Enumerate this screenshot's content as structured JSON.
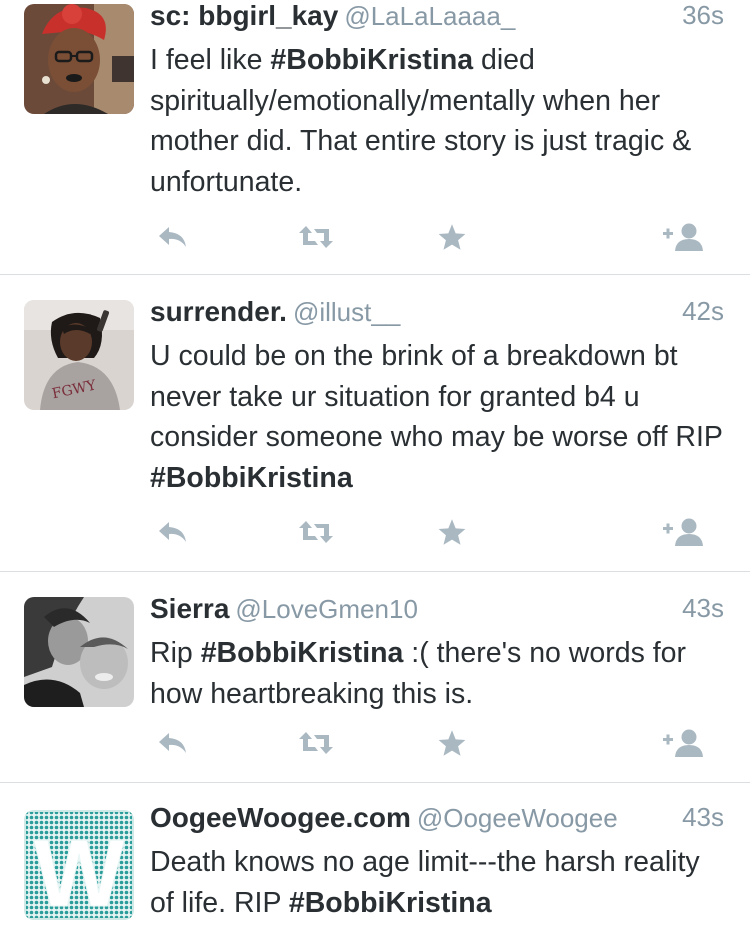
{
  "tweets": [
    {
      "name": "sc: bbgirl_kay",
      "handle": "@LaLaLaaaa_",
      "time": "36s",
      "text_before": "I feel like ",
      "hashtag": "#BobbiKristina",
      "text_after": " died spiritually/emotionally/mentally when her mother did. That entire story is just tragic & unfortunate."
    },
    {
      "name": "surrender.",
      "handle": "@illust__",
      "time": "42s",
      "text_before": "U could be on the brink of a breakdown bt never take ur situation for granted b4 u consider someone who may be worse off RIP ",
      "hashtag": "#BobbiKristina",
      "text_after": ""
    },
    {
      "name": "Sierra",
      "handle": "@LoveGmen10",
      "time": "43s",
      "text_before": "Rip ",
      "hashtag": "#BobbiKristina",
      "text_after": " :( there's no words for how heartbreaking this is."
    },
    {
      "name": "OogeeWoogee.com",
      "handle": "@OogeeWoogee",
      "time": "43s",
      "text_before": "Death knows no age limit---the harsh reality of life. RIP ",
      "hashtag": "#BobbiKristina",
      "text_after": ""
    }
  ],
  "avatar_letter": "W",
  "icons": {
    "reply": "reply-icon",
    "retweet": "retweet-icon",
    "favorite": "star-icon",
    "follow": "follow-user-icon"
  },
  "colors": {
    "name": "#292f33",
    "handle": "#8899a6",
    "action_icon": "#aab8c2",
    "divider": "#dcdfe2",
    "brand_teal": "#2a9d9a"
  }
}
